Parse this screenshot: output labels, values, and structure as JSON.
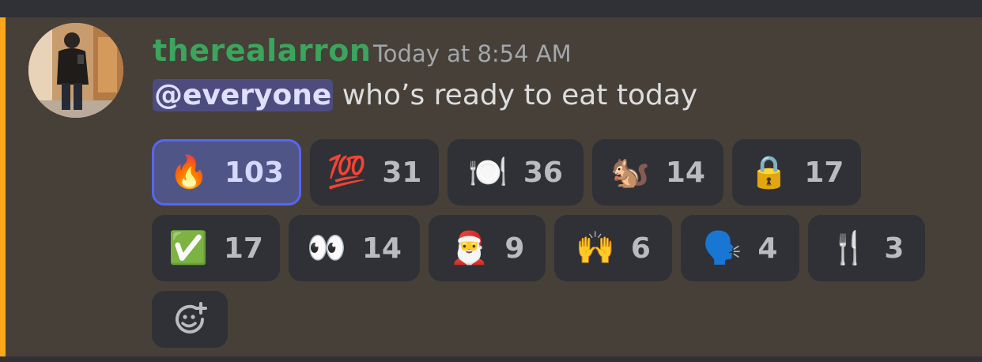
{
  "message": {
    "author": "therealarron",
    "timestamp": "Today at 8:54 AM",
    "mention": "@everyone",
    "text": " who’s ready to eat today"
  },
  "reactions": [
    {
      "emoji": "🔥",
      "count": "103",
      "name": "fire",
      "selected": true
    },
    {
      "emoji": "💯",
      "count": "31",
      "name": "hundred-points"
    },
    {
      "emoji": "🍽️",
      "count": "36",
      "name": "fork-and-knife-with-plate"
    },
    {
      "emoji": "🐿️",
      "count": "14",
      "name": "chipmunk"
    },
    {
      "emoji": "🔒",
      "count": "17",
      "name": "lock"
    },
    {
      "emoji": "✅",
      "count": "17",
      "name": "check-mark-button"
    },
    {
      "emoji": "👀",
      "count": "14",
      "name": "eyes"
    },
    {
      "emoji": "🎅",
      "count": "9",
      "name": "santa"
    },
    {
      "emoji": "🙌",
      "count": "6",
      "name": "raising-hands"
    },
    {
      "emoji": "🗣️",
      "count": "4",
      "name": "speaking-head"
    },
    {
      "emoji": "🍴",
      "count": "3",
      "name": "fork-and-knife"
    }
  ],
  "add_reaction_icon": "smiley-plus-icon",
  "colors": {
    "username": "#3ba55d",
    "mention_bar": "#faa81a",
    "selected_reaction_border": "#5865f2"
  }
}
